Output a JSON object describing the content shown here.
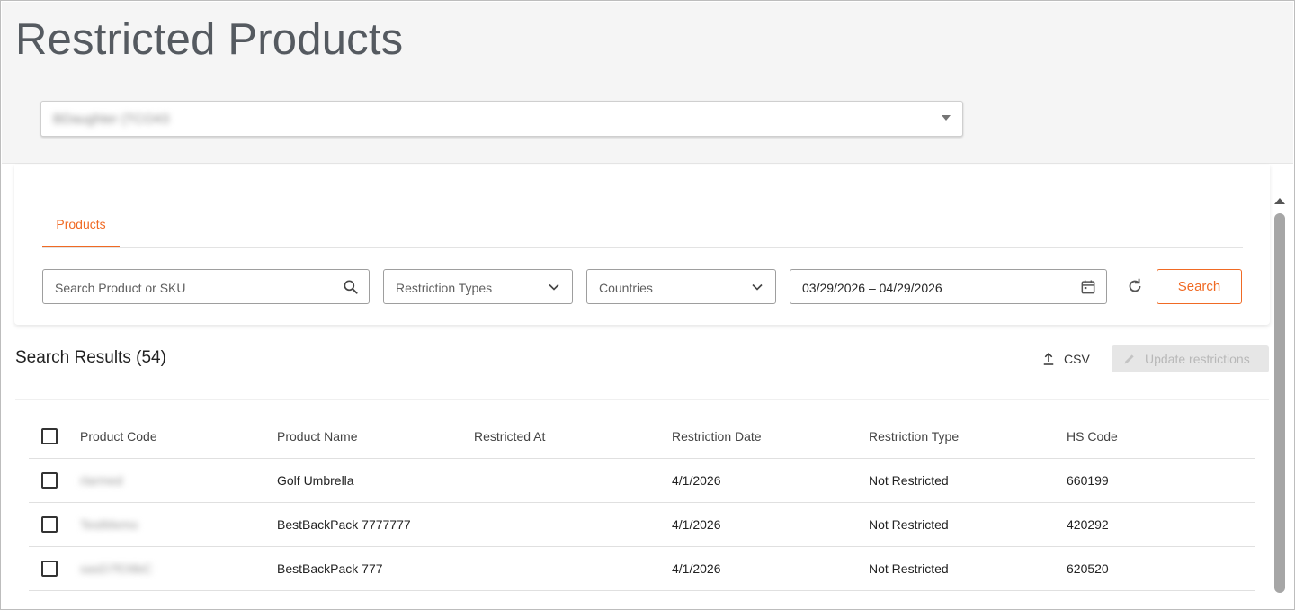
{
  "page": {
    "title": "Restricted Products",
    "account_select": {
      "value": "BDaughter (TCO43"
    }
  },
  "tabs": [
    {
      "label": "Products",
      "active": true
    }
  ],
  "filters": {
    "search": {
      "placeholder": "Search Product or SKU",
      "icon": "search-icon"
    },
    "restriction_types": {
      "label": "Restriction Types"
    },
    "countries": {
      "label": "Countries"
    },
    "date_range": {
      "value": "03/29/2026 – 04/29/2026",
      "icon": "calendar-icon"
    },
    "reset_icon": "refresh-icon",
    "search_button": "Search"
  },
  "results": {
    "title": "Search Results (54)",
    "csv_label": "CSV",
    "update_label": "Update restrictions"
  },
  "table": {
    "columns": [
      "Product Code",
      "Product Name",
      "Restricted At",
      "Restriction Date",
      "Restriction Type",
      "HS Code"
    ],
    "rows": [
      {
        "code": "rlarmed",
        "name": "Golf Umbrella",
        "restricted_at": "",
        "date": "4/1/2026",
        "type": "Not Restricted",
        "hs": "660199"
      },
      {
        "code": "TestMemo",
        "name": "BestBackPack 7777777",
        "restricted_at": "",
        "date": "4/1/2026",
        "type": "Not Restricted",
        "hs": "420292"
      },
      {
        "code": "sasD7fO9bC",
        "name": "BestBackPack 777",
        "restricted_at": "",
        "date": "4/1/2026",
        "type": "Not Restricted",
        "hs": "620520"
      }
    ]
  },
  "colors": {
    "accent": "#f06a24",
    "title": "#555a60",
    "header_bg": "#f5f5f5"
  }
}
